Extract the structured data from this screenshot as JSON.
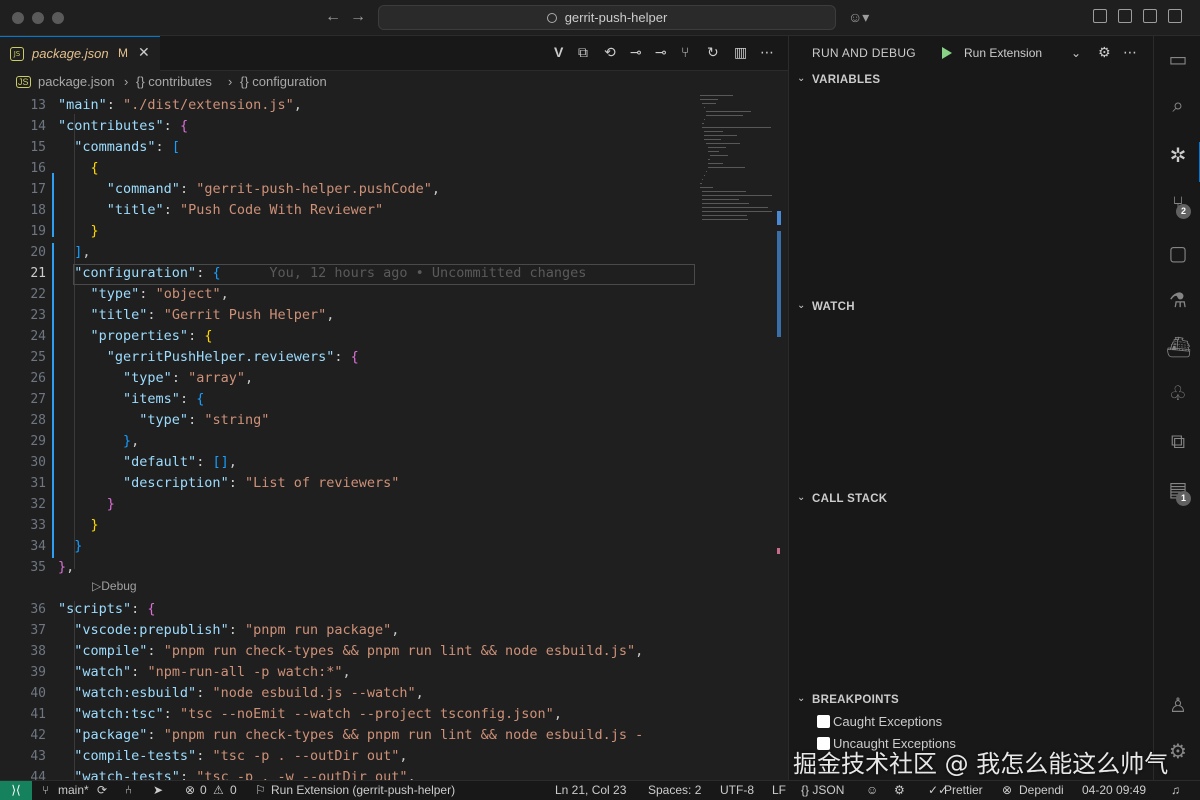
{
  "titlebar": {
    "search_text": "gerrit-push-helper"
  },
  "tab": {
    "icon_text": "JS",
    "filename": "package.json",
    "modified": "M",
    "close": "✕"
  },
  "breadcrumb": [
    "package.json",
    "{} contributes",
    "{} configuration"
  ],
  "editor": {
    "lines": [
      {
        "n": "13",
        "tokens": [
          [
            "k",
            "\"main\""
          ],
          [
            "p",
            ": "
          ],
          [
            "s",
            "\"./dist/extension.js\""
          ],
          [
            "p",
            ","
          ]
        ]
      },
      {
        "n": "14",
        "tokens": [
          [
            "k",
            "\"contributes\""
          ],
          [
            "p",
            ": "
          ],
          [
            "b2",
            "{"
          ]
        ]
      },
      {
        "n": "15",
        "tokens": [
          [
            "p",
            "  "
          ],
          [
            "k",
            "\"commands\""
          ],
          [
            "p",
            ": "
          ],
          [
            "b3",
            "["
          ]
        ]
      },
      {
        "n": "16",
        "tokens": [
          [
            "p",
            "    "
          ],
          [
            "b1",
            "{"
          ]
        ]
      },
      {
        "n": "17",
        "tokens": [
          [
            "p",
            "      "
          ],
          [
            "k",
            "\"command\""
          ],
          [
            "p",
            ": "
          ],
          [
            "s",
            "\"gerrit-push-helper.pushCode\""
          ],
          [
            "p",
            ","
          ]
        ]
      },
      {
        "n": "18",
        "tokens": [
          [
            "p",
            "      "
          ],
          [
            "k",
            "\"title\""
          ],
          [
            "p",
            ": "
          ],
          [
            "s",
            "\"Push Code With Reviewer\""
          ]
        ]
      },
      {
        "n": "19",
        "tokens": [
          [
            "p",
            "    "
          ],
          [
            "b1",
            "}"
          ]
        ]
      },
      {
        "n": "20",
        "tokens": [
          [
            "p",
            "  "
          ],
          [
            "b3",
            "]"
          ],
          [
            "p",
            ","
          ]
        ]
      },
      {
        "n": "21",
        "tokens": [
          [
            "p",
            "  "
          ],
          [
            "k",
            "\"configuration\""
          ],
          [
            "p",
            ": "
          ],
          [
            "b3",
            "{"
          ],
          [
            "ghost",
            "      You, 12 hours ago • Uncommitted changes"
          ]
        ]
      },
      {
        "n": "22",
        "tokens": [
          [
            "p",
            "    "
          ],
          [
            "k",
            "\"type\""
          ],
          [
            "p",
            ": "
          ],
          [
            "s",
            "\"object\""
          ],
          [
            "p",
            ","
          ]
        ]
      },
      {
        "n": "23",
        "tokens": [
          [
            "p",
            "    "
          ],
          [
            "k",
            "\"title\""
          ],
          [
            "p",
            ": "
          ],
          [
            "s",
            "\"Gerrit Push Helper\""
          ],
          [
            "p",
            ","
          ]
        ]
      },
      {
        "n": "24",
        "tokens": [
          [
            "p",
            "    "
          ],
          [
            "k",
            "\"properties\""
          ],
          [
            "p",
            ": "
          ],
          [
            "b1",
            "{"
          ]
        ]
      },
      {
        "n": "25",
        "tokens": [
          [
            "p",
            "      "
          ],
          [
            "k",
            "\"gerritPushHelper.reviewers\""
          ],
          [
            "p",
            ": "
          ],
          [
            "b2",
            "{"
          ]
        ]
      },
      {
        "n": "26",
        "tokens": [
          [
            "p",
            "        "
          ],
          [
            "k",
            "\"type\""
          ],
          [
            "p",
            ": "
          ],
          [
            "s",
            "\"array\""
          ],
          [
            "p",
            ","
          ]
        ]
      },
      {
        "n": "27",
        "tokens": [
          [
            "p",
            "        "
          ],
          [
            "k",
            "\"items\""
          ],
          [
            "p",
            ": "
          ],
          [
            "b3",
            "{"
          ]
        ]
      },
      {
        "n": "28",
        "tokens": [
          [
            "p",
            "          "
          ],
          [
            "k",
            "\"type\""
          ],
          [
            "p",
            ": "
          ],
          [
            "s",
            "\"string\""
          ]
        ]
      },
      {
        "n": "29",
        "tokens": [
          [
            "p",
            "        "
          ],
          [
            "b3",
            "}"
          ],
          [
            "p",
            ","
          ]
        ]
      },
      {
        "n": "30",
        "tokens": [
          [
            "p",
            "        "
          ],
          [
            "k",
            "\"default\""
          ],
          [
            "p",
            ": "
          ],
          [
            "b3",
            "[]"
          ],
          [
            "p",
            ","
          ]
        ]
      },
      {
        "n": "31",
        "tokens": [
          [
            "p",
            "        "
          ],
          [
            "k",
            "\"description\""
          ],
          [
            "p",
            ": "
          ],
          [
            "s",
            "\"List of reviewers\""
          ]
        ]
      },
      {
        "n": "32",
        "tokens": [
          [
            "p",
            "      "
          ],
          [
            "b2",
            "}"
          ]
        ]
      },
      {
        "n": "33",
        "tokens": [
          [
            "p",
            "    "
          ],
          [
            "b1",
            "}"
          ]
        ]
      },
      {
        "n": "34",
        "tokens": [
          [
            "p",
            "  "
          ],
          [
            "b3",
            "}"
          ]
        ]
      },
      {
        "n": "35",
        "tokens": [
          [
            "b2",
            "}"
          ],
          [
            "p",
            ","
          ]
        ]
      },
      {
        "n": "36",
        "tokens": [
          [
            "k",
            "\"scripts\""
          ],
          [
            "p",
            ": "
          ],
          [
            "b2",
            "{"
          ]
        ]
      },
      {
        "n": "37",
        "tokens": [
          [
            "p",
            "  "
          ],
          [
            "k",
            "\"vscode:prepublish\""
          ],
          [
            "p",
            ": "
          ],
          [
            "s",
            "\"pnpm run package\""
          ],
          [
            "p",
            ","
          ]
        ]
      },
      {
        "n": "38",
        "tokens": [
          [
            "p",
            "  "
          ],
          [
            "k",
            "\"compile\""
          ],
          [
            "p",
            ": "
          ],
          [
            "s",
            "\"pnpm run check-types && pnpm run lint && node esbuild.js\""
          ],
          [
            "p",
            ","
          ]
        ]
      },
      {
        "n": "39",
        "tokens": [
          [
            "p",
            "  "
          ],
          [
            "k",
            "\"watch\""
          ],
          [
            "p",
            ": "
          ],
          [
            "s",
            "\"npm-run-all -p watch:*\""
          ],
          [
            "p",
            ","
          ]
        ]
      },
      {
        "n": "40",
        "tokens": [
          [
            "p",
            "  "
          ],
          [
            "k",
            "\"watch:esbuild\""
          ],
          [
            "p",
            ": "
          ],
          [
            "s",
            "\"node esbuild.js --watch\""
          ],
          [
            "p",
            ","
          ]
        ]
      },
      {
        "n": "41",
        "tokens": [
          [
            "p",
            "  "
          ],
          [
            "k",
            "\"watch:tsc\""
          ],
          [
            "p",
            ": "
          ],
          [
            "s",
            "\"tsc --noEmit --watch --project tsconfig.json\""
          ],
          [
            "p",
            ","
          ]
        ]
      },
      {
        "n": "42",
        "tokens": [
          [
            "p",
            "  "
          ],
          [
            "k",
            "\"package\""
          ],
          [
            "p",
            ": "
          ],
          [
            "s",
            "\"pnpm run check-types && pnpm run lint && node esbuild.js -"
          ]
        ]
      },
      {
        "n": "43",
        "tokens": [
          [
            "p",
            "  "
          ],
          [
            "k",
            "\"compile-tests\""
          ],
          [
            "p",
            ": "
          ],
          [
            "s",
            "\"tsc -p . --outDir out\""
          ],
          [
            "p",
            ","
          ]
        ]
      },
      {
        "n": "44",
        "tokens": [
          [
            "p",
            "  "
          ],
          [
            "k",
            "\"watch-tests\""
          ],
          [
            "p",
            ": "
          ],
          [
            "s",
            "\"tsc -p . -w --outDir out\""
          ],
          [
            "p",
            ","
          ]
        ]
      }
    ],
    "codelens": "▷Debug"
  },
  "debug": {
    "title": "RUN AND DEBUG",
    "config": "Run Extension",
    "sections": {
      "variables": "VARIABLES",
      "watch": "WATCH",
      "callstack": "CALL STACK",
      "breakpoints": "BREAKPOINTS"
    },
    "breakpoint_items": [
      "Caught Exceptions",
      "Uncaught Exceptions"
    ]
  },
  "activity": {
    "badges": {
      "scm": "2",
      "extensions": "1"
    }
  },
  "statusbar": {
    "branch": "main*",
    "errors": "0",
    "warnings": "0",
    "launch": "Run Extension (gerrit-push-helper)",
    "position": "Ln 21, Col 23",
    "spaces": "Spaces: 2",
    "encoding": "UTF-8",
    "eol": "LF",
    "language": "{} JSON",
    "prettier": "Prettier",
    "dependi": "Dependi",
    "time": "04-20 09:49"
  },
  "watermark": "掘金技术社区 @ 我怎么能这么帅气",
  "colors": {
    "accent": "#0078d4",
    "remote": "#16825d",
    "play": "#89d185"
  }
}
